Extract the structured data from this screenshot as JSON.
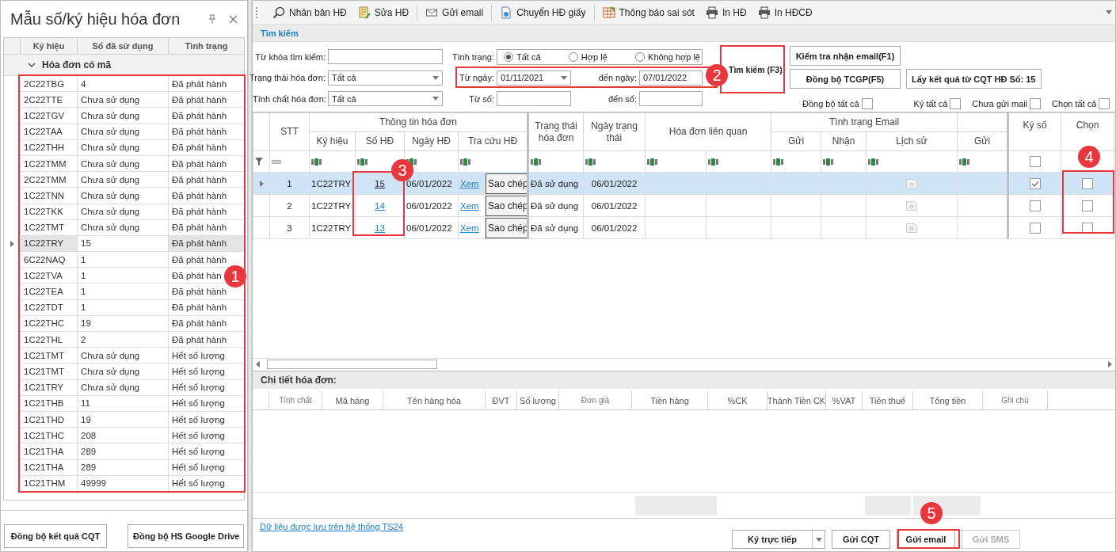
{
  "sidebar": {
    "title": "Mẫu số/ký hiệu hóa đơn",
    "columns": [
      "Ký hiệu",
      "Số đã sử dụng",
      "Tình trạng"
    ],
    "group": {
      "label": "Hóa đơn có mã",
      "expanded": true
    },
    "rows": [
      {
        "symbol": "2C22TBG",
        "used": "4",
        "status": "Đã phát hành",
        "selected": false
      },
      {
        "symbol": "2C22TTE",
        "used": "Chưa sử dụng",
        "status": "Đã phát hành",
        "selected": false
      },
      {
        "symbol": "1C22TGV",
        "used": "Chưa sử dụng",
        "status": "Đã phát hành",
        "selected": false
      },
      {
        "symbol": "1C22TAA",
        "used": "Chưa sử dụng",
        "status": "Đã phát hành",
        "selected": false
      },
      {
        "symbol": "1C22THH",
        "used": "Chưa sử dụng",
        "status": "Đã phát hành",
        "selected": false
      },
      {
        "symbol": "1C22TMM",
        "used": "Chưa sử dụng",
        "status": "Đã phát hành",
        "selected": false
      },
      {
        "symbol": "2C22TMM",
        "used": "Chưa sử dụng",
        "status": "Đã phát hành",
        "selected": false
      },
      {
        "symbol": "1C22TNN",
        "used": "Chưa sử dụng",
        "status": "Đã phát hành",
        "selected": false
      },
      {
        "symbol": "1C22TKK",
        "used": "Chưa sử dụng",
        "status": "Đã phát hành",
        "selected": false
      },
      {
        "symbol": "1C22TMT",
        "used": "Chưa sử dụng",
        "status": "Đã phát hành",
        "selected": false
      },
      {
        "symbol": "1C22TRY",
        "used": "15",
        "status": "Đã phát hành",
        "selected": true
      },
      {
        "symbol": "6C22NAQ",
        "used": "1",
        "status": "Đã phát hành",
        "selected": false
      },
      {
        "symbol": "1C22TVA",
        "used": "1",
        "status": "Đã phát hàn",
        "selected": false
      },
      {
        "symbol": "1C22TEA",
        "used": "1",
        "status": "Đã phát hành",
        "selected": false
      },
      {
        "symbol": "1C22TDT",
        "used": "1",
        "status": "Đã phát hành",
        "selected": false
      },
      {
        "symbol": "1C22THC",
        "used": "19",
        "status": "Đã phát hành",
        "selected": false
      },
      {
        "symbol": "1C22THL",
        "used": "2",
        "status": "Đã phát hành",
        "selected": false
      },
      {
        "symbol": "1C21TMT",
        "used": "Chưa sử dụng",
        "status": "Hết số lượng",
        "selected": false
      },
      {
        "symbol": "1C21TMT",
        "used": "Chưa sử dụng",
        "status": "Hết số lượng",
        "selected": false
      },
      {
        "symbol": "1C21TRY",
        "used": "Chưa sử dụng",
        "status": "Hết số lượng",
        "selected": false
      },
      {
        "symbol": "1C21THB",
        "used": "11",
        "status": "Hết số lượng",
        "selected": false
      },
      {
        "symbol": "1C21THD",
        "used": "19",
        "status": "Hết số lượng",
        "selected": false
      },
      {
        "symbol": "1C21THC",
        "used": "208",
        "status": "Hết số lượng",
        "selected": false
      },
      {
        "symbol": "1C21THA",
        "used": "289",
        "status": "Hết số lượng",
        "selected": false
      },
      {
        "symbol": "1C21THA",
        "used": "289",
        "status": "Hết số lượng",
        "selected": false
      },
      {
        "symbol": "1C21THM",
        "used": "49999",
        "status": "Hết số lượng",
        "selected": false
      }
    ],
    "buttons": [
      "Đồng bộ kết quả CQT",
      "Đồng bộ HS Google Drive"
    ]
  },
  "toolbar": [
    {
      "label": "Nhân bản HĐ",
      "kind": "search",
      "separated": false
    },
    {
      "label": "Sửa HĐ",
      "kind": "edit",
      "separated": false
    },
    {
      "label": "Gửi email",
      "kind": "mail",
      "separated": true
    },
    {
      "label": "Chuyển HĐ giấy",
      "kind": "document",
      "separated": true
    },
    {
      "label": "Thông báo sai sót",
      "kind": "report",
      "separated": true
    },
    {
      "label": "In HĐ",
      "kind": "print",
      "separated": false
    },
    {
      "label": "In HĐCĐ",
      "kind": "print",
      "separated": false
    }
  ],
  "search": {
    "title": "Tìm kiếm",
    "keyword_label": "Từ khóa tìm kiếm:",
    "invoice_status_label": "Trạng thái hóa đơn:",
    "invoice_status": "Tất cả",
    "invoice_type_label": "Tính chất hóa đơn:",
    "invoice_type": "Tất cả",
    "state_label": "Tình trạng:",
    "state_options": [
      {
        "label": "Tất cả",
        "selected": true
      },
      {
        "label": "Hợp lệ",
        "selected": false
      },
      {
        "label": "Không hợp lệ",
        "selected": false
      }
    ],
    "from_date_label": "Từ ngày:",
    "from_date": "01/11/2021",
    "to_date_label": "đến ngày:",
    "to_date": "07/01/2022",
    "from_number_label": "Từ số:",
    "to_number_label": "đến số:",
    "search_button": {
      "label": "Tìm kiếm (F3)",
      "highlighted": true
    },
    "buttons": [
      "Kiểm tra nhận email(F1)",
      "Đồng bộ TCGP(F5)",
      "Lấy kết quả từ CQT HĐ Số: 15"
    ],
    "toggles": [
      {
        "label": "Đồng bộ tất cả",
        "checked": false
      },
      {
        "label": "Ký tất cả",
        "checked": false
      },
      {
        "label": "Chưa gửi mail",
        "checked": false
      },
      {
        "label": "Chọn tất cả",
        "checked": false
      }
    ]
  },
  "grid": {
    "headers": {
      "stt": "STT",
      "info": "Thông tin hóa đơn",
      "symbol": "Ký hiệu",
      "number": "Số HĐ",
      "date": "Ngày HĐ",
      "lookup": "Tra cứu HĐ",
      "invoice_status": "Trạng thái hóa đơn",
      "status_date": "Ngày trạng thái",
      "related": "Hóa đơn liên quan",
      "email_status": "Tình trạng Email",
      "sent": "Gửi",
      "received": "Nhận",
      "history": "Lịch sử",
      "send": "Gửi",
      "sign": "Ký số",
      "choose": "Chọn"
    },
    "sign_filter_checked": false,
    "rows": [
      {
        "stt": "1",
        "symbol": "1C22TRY",
        "number": "15",
        "date": "06/01/2022",
        "view": "Xem",
        "copy": "Sao chép",
        "status": "Đã sử dụng",
        "status_date": "06/01/2022",
        "signed": true,
        "chosen": false,
        "selected": true
      },
      {
        "stt": "2",
        "symbol": "1C22TRY",
        "number": "14",
        "date": "06/01/2022",
        "view": "Xem",
        "copy": "Sao chép",
        "status": "Đã sử dụng",
        "status_date": "06/01/2022",
        "signed": false,
        "chosen": false,
        "selected": false
      },
      {
        "stt": "3",
        "symbol": "1C22TRY",
        "number": "13",
        "date": "06/01/2022",
        "view": "Xem",
        "copy": "Sao chép",
        "status": "Đã sử dụng",
        "status_date": "06/01/2022",
        "signed": false,
        "chosen": false,
        "selected": false
      }
    ]
  },
  "detail": {
    "title": "Chi tiết hóa đơn:",
    "columns": [
      "Tính chất",
      "Mã hàng",
      "Tên hàng hóa",
      "ĐVT",
      "Số lượng",
      "Đơn giá",
      "Tiền hàng",
      "%CK",
      "Thành Tiền CK",
      "%VAT",
      "Tiền thuế",
      "Tổng tiền",
      "Ghi chú"
    ]
  },
  "footer": {
    "link": "Dữ liệu được lưu trên hệ thống TS24",
    "buttons": [
      {
        "label": "Ký trực tiếp",
        "kind": "split",
        "disabled": false
      },
      {
        "label": "Gửi CQT",
        "kind": "plain",
        "disabled": false
      },
      {
        "label": "Gửi email",
        "kind": "plain",
        "disabled": false
      },
      {
        "label": "Gửi SMS",
        "kind": "plain",
        "disabled": true
      }
    ]
  },
  "callouts": [
    {
      "number": "1"
    },
    {
      "number": "2"
    },
    {
      "number": "3"
    },
    {
      "number": "4"
    },
    {
      "number": "5"
    }
  ]
}
